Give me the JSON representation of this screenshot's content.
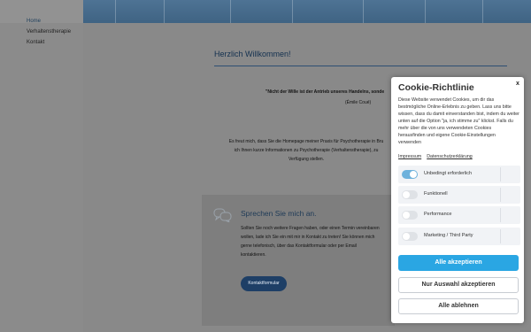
{
  "nav": {
    "items": [
      {
        "label": "Home",
        "active": true
      },
      {
        "label": "Verhaltenstherapie",
        "active": false
      },
      {
        "label": "Kontakt",
        "active": false
      }
    ]
  },
  "main": {
    "title": "Herzlich Willkommen!",
    "quote": "\"Nicht der Wille ist der Antrieb unseres Handelns, sonde",
    "quote_author": "(Émile Coué)",
    "intro_line1": "Es freut mich, dass Sie die Homepage meiner Praxis für Psychotherapie in Bru",
    "intro_line2": "ich Ihnen kurze Informationen zu Psychotherapie (Verhaltenstherapie), zu",
    "intro_line3": "Verfügung stellen."
  },
  "contact": {
    "heading": "Sprechen Sie mich an.",
    "text": "Sollten Sie noch weitere Fragen haben, oder einen Termin vereinbaren wollen, lade ich Sie ein mit mir in Kontakt zu treten! Sie können mich gerne telefonisch, über das Kontaktformular oder per Email kontaktieren.",
    "button_label": "Kontaktformular"
  },
  "cookie": {
    "close_label": "x",
    "title": "Cookie-Richtlinie",
    "description": "Diese Website verwendet Cookies, um dir das bestmögliche Online-Erlebnis zu geben. Lass uns bitte wissen, dass du damit einverstanden bist, indem du weiter unten auf die Option \"ja, ich stimme zu\" klickst. Falls du mehr über die von uns verwendeten Cookies herausfinden und eigene Cookie-Einstellungen verwenden",
    "links": {
      "impressum": "Impressum",
      "datenschutz": "Datenschutzerklärung"
    },
    "options": [
      {
        "label": "Unbedingt erforderlich",
        "enabled": true
      },
      {
        "label": "Funktionell",
        "enabled": false
      },
      {
        "label": "Performance",
        "enabled": false
      },
      {
        "label": "Marketing / Third Party",
        "enabled": false
      }
    ],
    "accept_all": "Alle akzeptieren",
    "accept_selection": "Nur Auswahl akzeptieren",
    "reject_all": "Alle ablehnen"
  },
  "colors": {
    "overlay": "#898989",
    "accent": "#2aa6e3",
    "toggle_on": "#6eb2dc",
    "brand_dark": "#1e3f66"
  }
}
